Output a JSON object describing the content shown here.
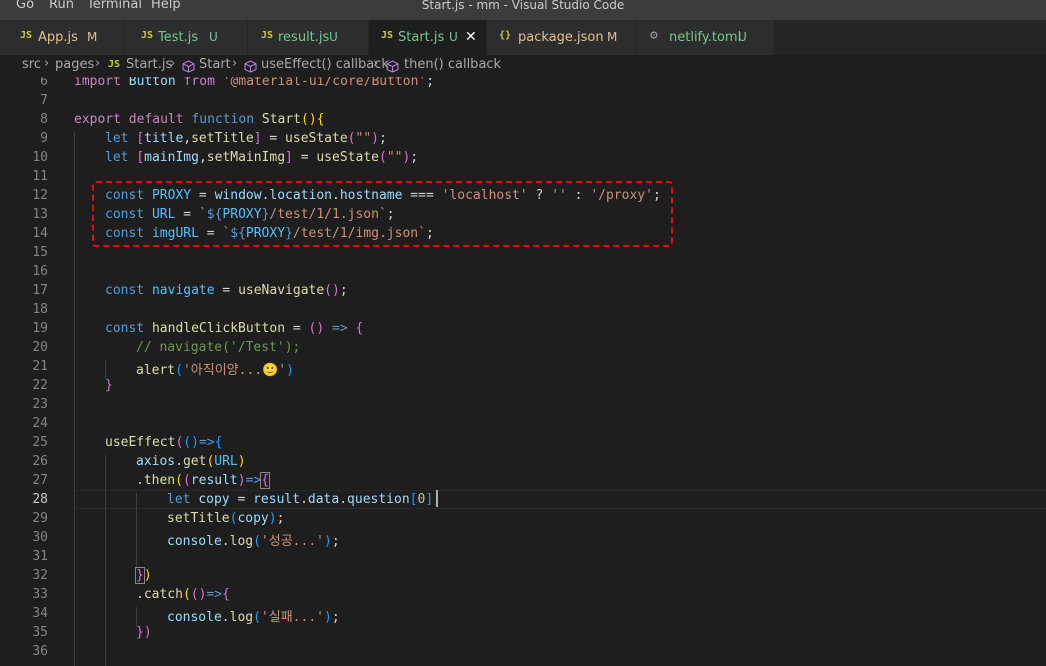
{
  "menu": [
    "Go",
    "Run",
    "Terminal",
    "Help"
  ],
  "window_title": "Start.js - mm - Visual Studio Code",
  "tabs": [
    {
      "icon": "JS",
      "label": "App.js",
      "status": "M"
    },
    {
      "icon": "JS",
      "label": "Test.js",
      "status": "U"
    },
    {
      "icon": "JS",
      "label": "result.js",
      "status": "U"
    },
    {
      "icon": "JS",
      "label": "Start.js",
      "status": "U",
      "close": "✕"
    },
    {
      "icon": "{}",
      "label": "package.json",
      "status": "M"
    },
    {
      "icon": "⚙",
      "label": "netlify.toml",
      "status": "U"
    }
  ],
  "breadcrumb": {
    "src": "src",
    "pages": "pages",
    "file_icon": "JS",
    "file": "Start.js",
    "item1": "Start",
    "item2": "useEffect() callback",
    "item3": "then() callback"
  },
  "line_numbers": [
    "6",
    "7",
    "8",
    "9",
    "10",
    "11",
    "12",
    "13",
    "14",
    "15",
    "16",
    "17",
    "18",
    "19",
    "20",
    "21",
    "22",
    "23",
    "24",
    "25",
    "26",
    "27",
    "28",
    "29",
    "30",
    "31",
    "32",
    "33",
    "34",
    "35",
    "36"
  ],
  "code": {
    "l6": {
      "a": "import",
      "b": " Button ",
      "c": "from",
      "d": " '@material-ui/core/Button'",
      "e": ";"
    },
    "l8": {
      "a": "export",
      "b": " ",
      "c": "default",
      "d": " ",
      "e": "function",
      "f": " ",
      "g": "Start",
      "h": "()",
      "i": "{"
    },
    "l9": {
      "a": "let",
      "b": " ",
      "c": "[",
      "d": "title",
      "e": ",",
      "f": "setTitle",
      "g": "]",
      "h": " = ",
      "i": "useState",
      "j": "(",
      "k": "\"\"",
      "l": ")",
      "m": ";"
    },
    "l10": {
      "a": "let",
      "b": " ",
      "c": "[",
      "d": "mainImg",
      "e": ",",
      "f": "setMainImg",
      "g": "]",
      "h": " = ",
      "i": "useState",
      "j": "(",
      "k": "\"\"",
      "l": ")",
      "m": ";"
    },
    "l12": {
      "a": "const",
      "b": " ",
      "c": "PROXY",
      "d": " = ",
      "e": "window",
      "f": ".",
      "g": "location",
      "h": ".",
      "i": "hostname",
      "j": " === ",
      "k": "'localhost'",
      "l": " ? ",
      "m": "''",
      "n": " : ",
      "o": "'/proxy'",
      "p": ";"
    },
    "l13": {
      "a": "const",
      "b": " ",
      "c": "URL",
      "d": " = ",
      "e": "`",
      "f": "${",
      "g": "PROXY",
      "h": "}",
      "i": "/test/1/1.json`",
      "j": ";"
    },
    "l14": {
      "a": "const",
      "b": " ",
      "c": "imgURL",
      "d": " = ",
      "e": "`",
      "f": "${",
      "g": "PROXY",
      "h": "}",
      "i": "/test/1/img.json`",
      "j": ";"
    },
    "l17": {
      "a": "const",
      "b": " ",
      "c": "navigate",
      "d": " = ",
      "e": "useNavigate",
      "f": "()",
      "g": ";"
    },
    "l19": {
      "a": "const",
      "b": " ",
      "c": "handleClickButton",
      "d": " = ",
      "e": "()",
      "f": " => ",
      "g": "{"
    },
    "l20": {
      "a": "// navigate('/Test');"
    },
    "l21": {
      "a": "alert",
      "b": "(",
      "c": "'아직이양...🙂'",
      "d": ")"
    },
    "l22": {
      "a": "}"
    },
    "l25": {
      "a": "useEffect",
      "b": "(",
      "c": "()",
      "d": "=>",
      "e": "{"
    },
    "l26": {
      "a": "axios",
      "b": ".",
      "c": "get",
      "d": "(",
      "e": "URL",
      "f": ")"
    },
    "l27": {
      "a": ".",
      "b": "then",
      "c": "(",
      "d": "(",
      "e": "result",
      "f": ")",
      "g": "=>",
      "h": "{"
    },
    "l28": {
      "a": "let",
      "b": " ",
      "c": "copy",
      "d": " = ",
      "e": "result",
      "f": ".",
      "g": "data",
      "h": ".",
      "i": "question",
      "j": "[",
      "k": "0",
      "l": "]",
      "m": ";"
    },
    "l29": {
      "a": "setTitle",
      "b": "(",
      "c": "copy",
      "d": ")",
      "e": ";"
    },
    "l30": {
      "a": "console",
      "b": ".",
      "c": "log",
      "d": "(",
      "e": "'성공...'",
      "f": ")",
      "g": ";"
    },
    "l32": {
      "a": "}",
      "b": ")"
    },
    "l33": {
      "a": ".",
      "b": "catch",
      "c": "(",
      "d": "()",
      "e": "=>",
      "f": "{"
    },
    "l34": {
      "a": "console",
      "b": ".",
      "c": "log",
      "d": "(",
      "e": "'실패...'",
      "f": ")",
      "g": ";"
    },
    "l35": {
      "a": "})"
    }
  },
  "colors": {
    "keyword": "#569cd6",
    "control": "#c586c0",
    "function": "#dcdcaa",
    "variable": "#9cdcfe",
    "constant": "#4fc1ff",
    "string": "#ce9178",
    "comment": "#6a9955",
    "highlight_border": "#e01010"
  }
}
